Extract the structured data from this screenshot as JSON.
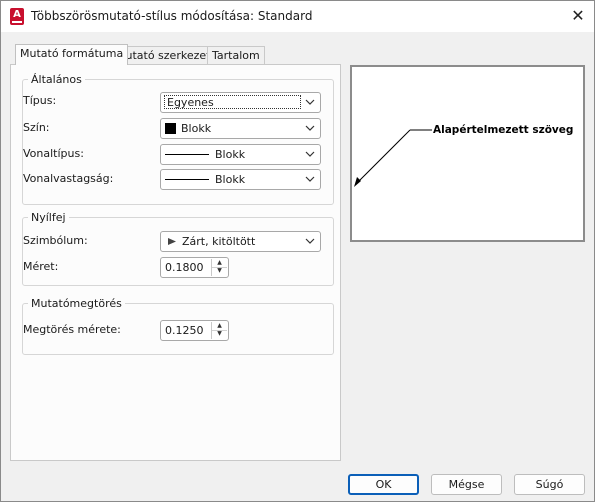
{
  "window": {
    "title": "Többszörösmutató-stílus módosítása: Standard"
  },
  "tabs": [
    {
      "label": "Mutató formátuma",
      "active": true
    },
    {
      "label": "Mutató szerkezete",
      "active": false
    },
    {
      "label": "Tartalom",
      "active": false
    }
  ],
  "general": {
    "legend": "Általános",
    "type_label": "Típus:",
    "type_value": "Egyenes",
    "color_label": "Szín:",
    "color_value": "Blokk",
    "linetype_label": "Vonaltípus:",
    "linetype_value": "Blokk",
    "lineweight_label": "Vonalvastagság:",
    "lineweight_value": "Blokk"
  },
  "arrowhead": {
    "legend": "Nyílfej",
    "symbol_label": "Szimbólum:",
    "symbol_value": "Zárt, kitöltött",
    "size_label": "Méret:",
    "size_value": "0.1800"
  },
  "landing_break": {
    "legend": "Mutatómegtörés",
    "break_label": "Megtörés mérete:",
    "break_value": "0.1250"
  },
  "preview": {
    "text": "Alapértelmezett szöveg"
  },
  "buttons": {
    "ok": "OK",
    "cancel": "Mégse",
    "help": "Súgó"
  },
  "colors": {
    "accent": "#0b5fb8",
    "app_icon": "#c8102e"
  }
}
